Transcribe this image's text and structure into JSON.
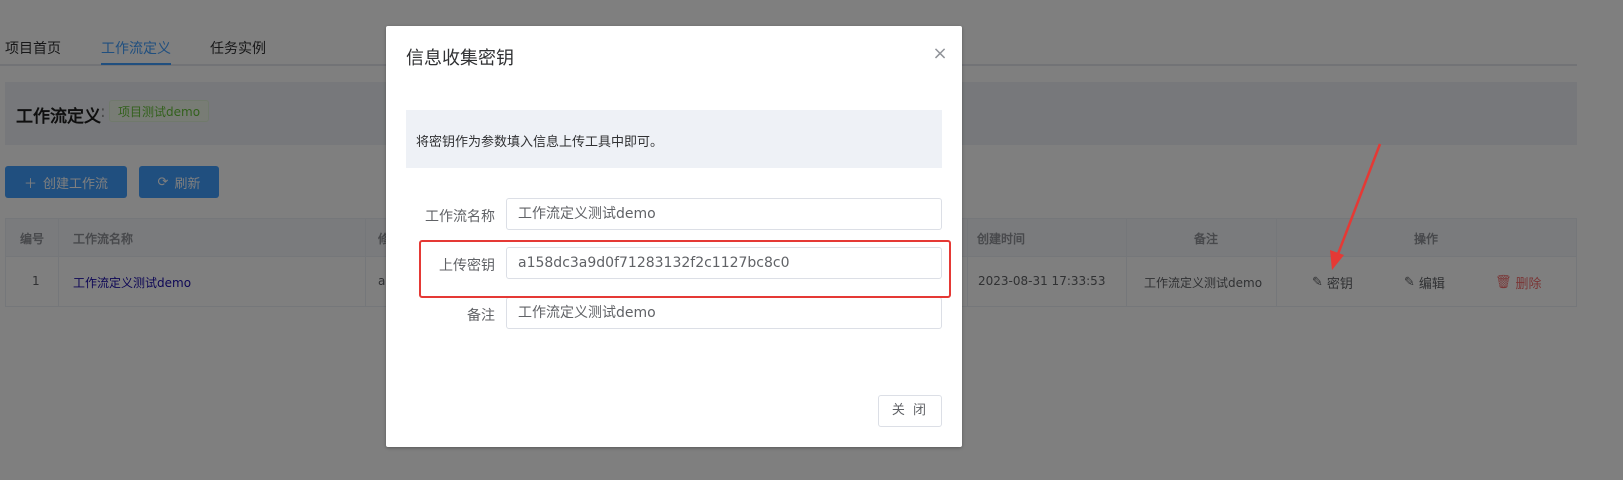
{
  "tabs": [
    {
      "label": "项目首页"
    },
    {
      "label": "工作流定义"
    },
    {
      "label": "任务实例"
    }
  ],
  "definition": {
    "title": "工作流定义",
    "colon": ":",
    "project_tag": "项目测试demo"
  },
  "toolbar": {
    "create_label": "创建工作流",
    "refresh_label": "刷新"
  },
  "table": {
    "headers": {
      "id": "编号",
      "name": "工作流名称",
      "col3": "修",
      "created": "创建时间",
      "remark": "备注",
      "actions": "操作"
    },
    "rows": [
      {
        "id": "1",
        "name": "工作流定义测试demo",
        "col3": "a",
        "created": "2023-08-31 17:33:53",
        "remark": "工作流定义测试demo",
        "key_label": "密钥",
        "edit_label": "编辑",
        "delete_label": "删除"
      }
    ]
  },
  "dialog": {
    "title": "信息收集密钥",
    "tip": "将密钥作为参数填入信息上传工具中即可。",
    "fields": [
      {
        "label": "工作流名称",
        "value": "工作流定义测试demo"
      },
      {
        "label": "上传密钥",
        "value": "a158dc3a9d0f71283132f2c1127bc8c0"
      },
      {
        "label": "备注",
        "value": "工作流定义测试demo"
      }
    ],
    "close_label": "关 闭"
  },
  "colors": {
    "primary": "#409eff",
    "danger": "#f56c6c",
    "success_tag": "#67c23a",
    "highlight": "#e53935"
  }
}
